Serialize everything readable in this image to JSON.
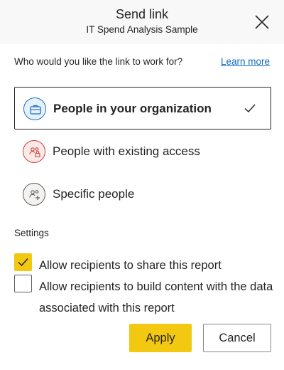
{
  "header": {
    "title": "Send link",
    "subtitle": "IT Spend Analysis Sample",
    "close_icon": "close-icon"
  },
  "prompt": {
    "question": "Who would you like the link to work for?",
    "learn_more": "Learn more"
  },
  "options": [
    {
      "label": "People in your organization",
      "icon": "briefcase-icon",
      "selected": true,
      "icon_color": "#1b6ec2",
      "icon_bg": "#e6f1fb"
    },
    {
      "label": "People with existing access",
      "icon": "people-lock-icon",
      "selected": false,
      "icon_color": "#c4453a",
      "icon_bg": "#fbe9e7"
    },
    {
      "label": "Specific people",
      "icon": "people-add-icon",
      "selected": false,
      "icon_color": "#605e5c",
      "icon_bg": "#f3f2f1"
    }
  ],
  "settings": {
    "title": "Settings",
    "checkboxes": [
      {
        "label": "Allow recipients to share this report",
        "checked": true
      },
      {
        "label": "Allow recipients to build content with the data associated with this report",
        "checked": false
      }
    ]
  },
  "actions": {
    "apply": "Apply",
    "cancel": "Cancel"
  },
  "colors": {
    "accent": "#f2c811",
    "link": "#0f6cbd"
  }
}
